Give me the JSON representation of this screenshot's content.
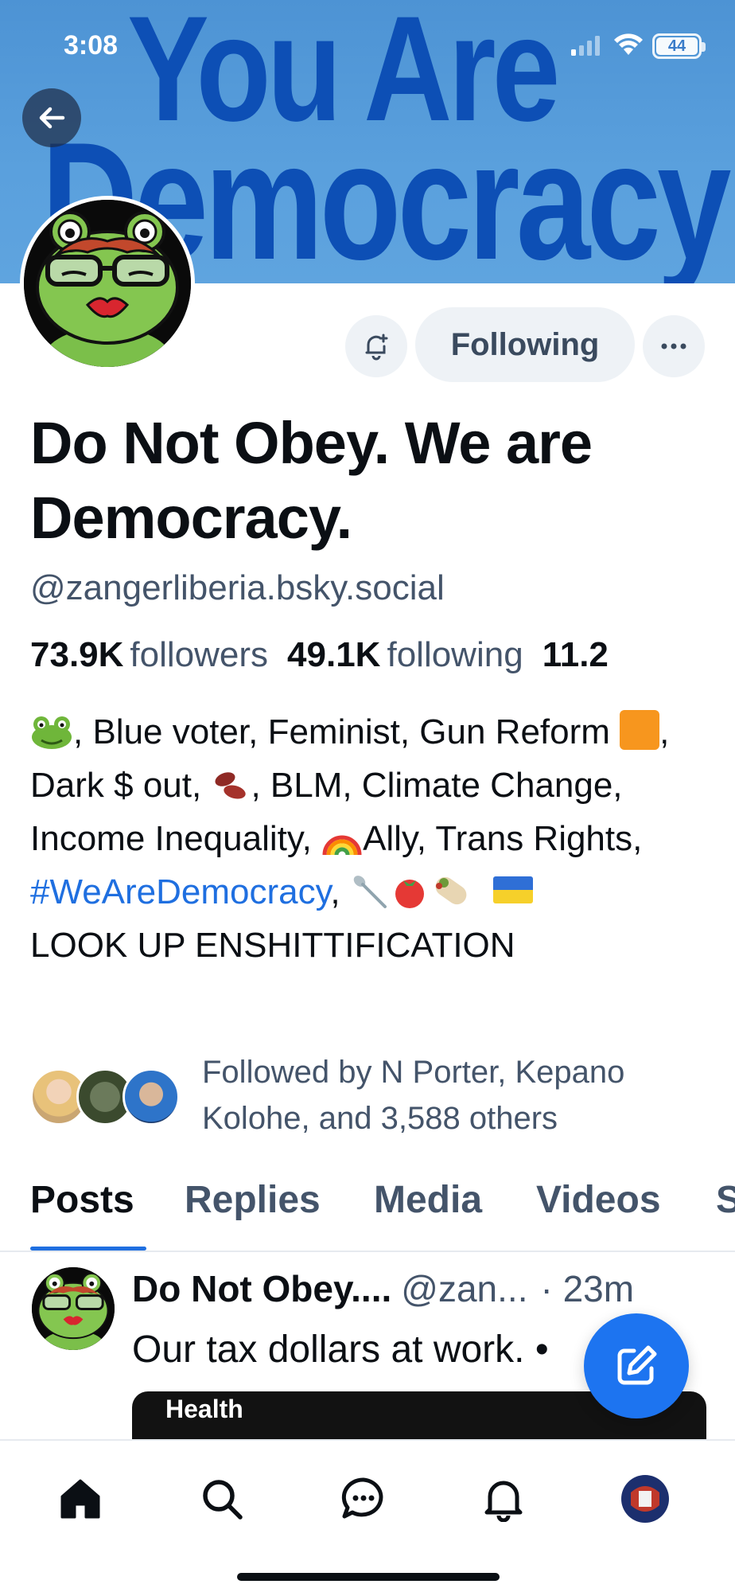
{
  "status_bar": {
    "time": "3:08",
    "battery": "44"
  },
  "banner": {
    "line1": "You Are",
    "line2": "Democracy"
  },
  "actions": {
    "following_label": "Following"
  },
  "profile": {
    "display_name": "Do Not Obey. We are Democracy.",
    "handle": "@zangerliberia.bsky.social",
    "followers_count": "73.9K",
    "followers_label": "followers",
    "following_count": "49.1K",
    "following_label": "following",
    "posts_count_partial": "11.2",
    "bio": {
      "seg1": ", Blue voter, Feminist, Gun Reform ",
      "seg2": ", Dark $ out, ",
      "seg3": ", BLM, Climate Change, Income Inequality, ",
      "seg4": "Ally, Trans Rights, ",
      "hashtag": "#WeAreDemocracy",
      "seg5": ", ",
      "seg6": "LOOK UP ENSHITTIFICATION"
    },
    "followed_by": "Followed by N Porter, Kepano Kolohe, and 3,588 others"
  },
  "tabs": [
    "Posts",
    "Replies",
    "Media",
    "Videos",
    "S"
  ],
  "post": {
    "name": "Do Not Obey....",
    "handle": "@zan...",
    "time": "· 23m",
    "text": "Our tax dollars at work. •",
    "media_label": "Health"
  },
  "colors": {
    "accent": "#1f6fe0",
    "banner": "#4d93d4",
    "banner_text": "#0d4fb5"
  }
}
